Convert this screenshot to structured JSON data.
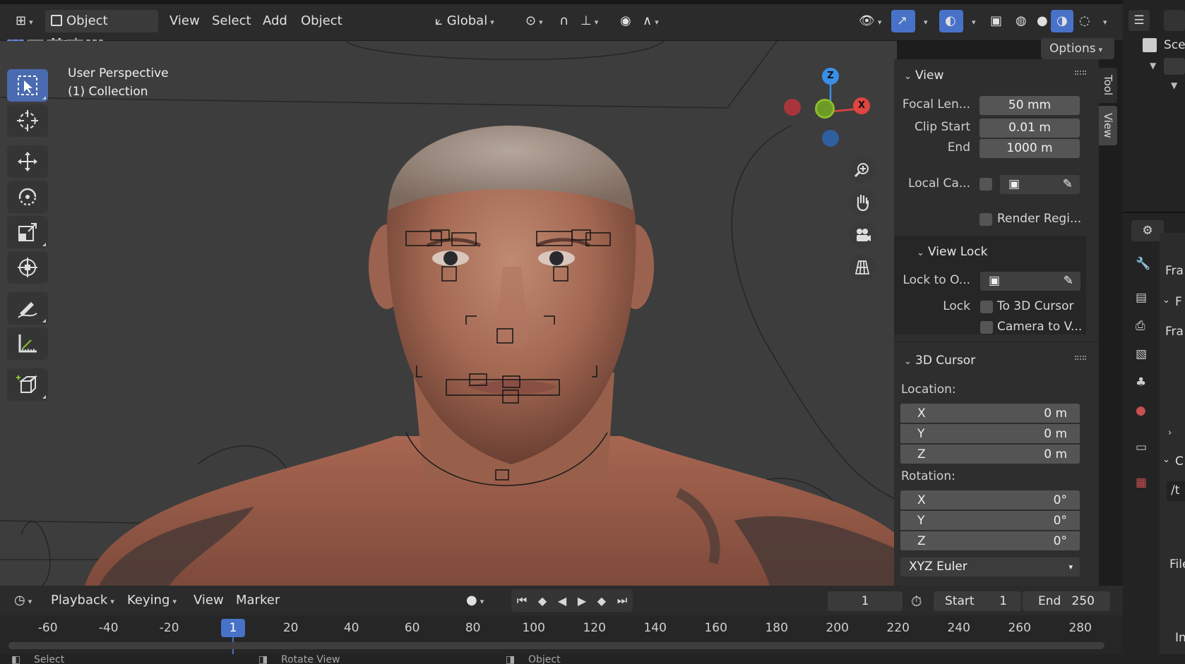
{
  "header": {
    "mode": "Object Mode",
    "menus": [
      "View",
      "Select",
      "Add",
      "Object"
    ],
    "transform_orientation": "Global",
    "options_label": "Options"
  },
  "viewport": {
    "perspective_label": "User Perspective",
    "collection_label": "(1) Collection",
    "gizmo": {
      "x": "X",
      "y": "Y",
      "z": "Z"
    }
  },
  "tools": [
    "select-box",
    "cursor",
    "move",
    "rotate",
    "scale",
    "transform",
    "annotate",
    "measure",
    "add-cube"
  ],
  "sidebar_tabs": {
    "tool": "Tool",
    "view": "View"
  },
  "view_panel": {
    "title": "View",
    "focal_length_label": "Focal Len...",
    "focal_length": "50 mm",
    "clip_start_label": "Clip Start",
    "clip_start": "0.01 m",
    "clip_end_label": "End",
    "clip_end": "1000 m",
    "local_camera_label": "Local Ca...",
    "render_region_label": "Render Regi...",
    "view_lock": {
      "title": "View Lock",
      "lock_to_object_label": "Lock to O...",
      "lock_label": "Lock",
      "to_3d_cursor": "To 3D Cursor",
      "camera_to_view": "Camera to V..."
    }
  },
  "cursor_panel": {
    "title": "3D Cursor",
    "location_label": "Location:",
    "location": {
      "x_label": "X",
      "x": "0 m",
      "y_label": "Y",
      "y": "0 m",
      "z_label": "Z",
      "z": "0 m"
    },
    "rotation_label": "Rotation:",
    "rotation": {
      "x_label": "X",
      "x": "0°",
      "y_label": "Y",
      "y": "0°",
      "z_label": "Z",
      "z": "0°"
    },
    "rotation_mode": "XYZ Euler"
  },
  "right_column": {
    "scene_label": "Sce",
    "frame_label_1": "Fra",
    "frame_label_2": "Fra",
    "section_letter_1": "F",
    "section_letter_2": "C",
    "path_text": "/t",
    "file_label": "File",
    "in_label": "In"
  },
  "timeline": {
    "menus": [
      "Playback",
      "Keying",
      "View",
      "Marker"
    ],
    "current_frame": "1",
    "current_frame_field": "1",
    "start_label": "Start",
    "start_value": "1",
    "end_label": "End",
    "end_value": "250",
    "ticks": [
      "-60",
      "-40",
      "-20",
      "20",
      "40",
      "60",
      "80",
      "100",
      "120",
      "140",
      "160",
      "180",
      "200",
      "220",
      "240",
      "260",
      "280"
    ]
  },
  "statusbar": {
    "left": "Select",
    "middle": "Rotate View",
    "right": "Object"
  },
  "colors": {
    "accent": "#4772c8",
    "x_axis": "#e0453f",
    "y_axis": "#8bbd2c",
    "z_axis": "#3a8ee6"
  }
}
